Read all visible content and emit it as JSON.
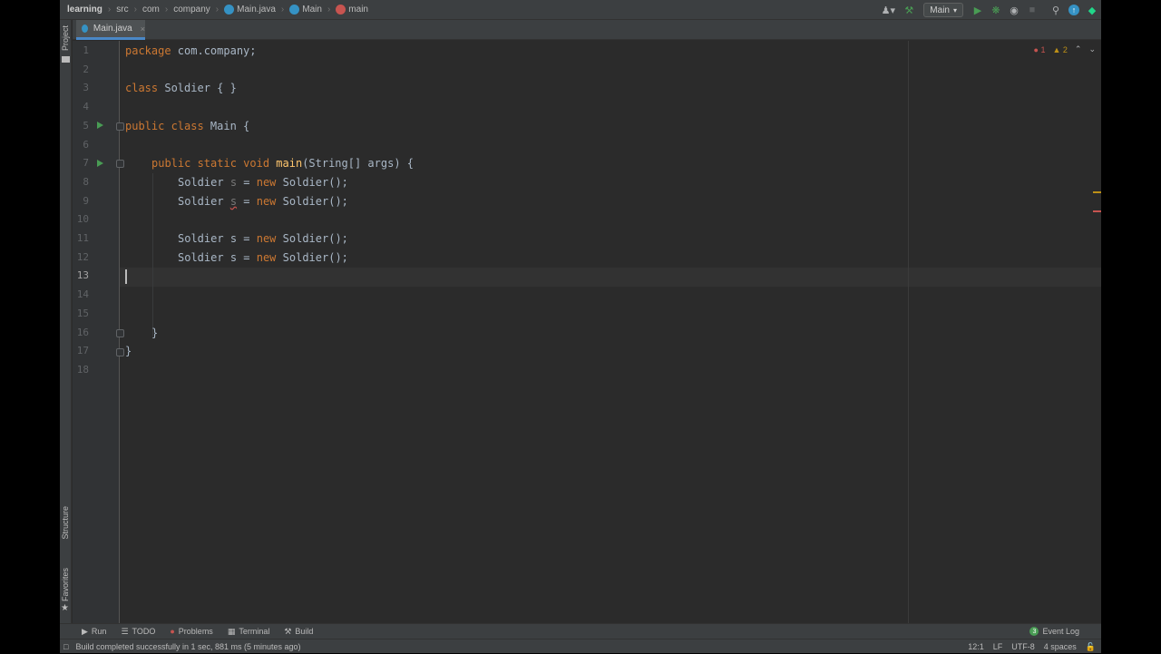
{
  "breadcrumbs": [
    "learning",
    "src",
    "com",
    "company",
    "Main.java",
    "Main",
    "main"
  ],
  "toolbar": {
    "run_config": "Main"
  },
  "left_strip": {
    "project_label": "Project",
    "structure_label": "Structure",
    "favorites_label": "Favorites"
  },
  "tabs": [
    {
      "label": "Main.java",
      "close": "×"
    }
  ],
  "editor": {
    "line_numbers": [
      "1",
      "2",
      "3",
      "4",
      "5",
      "6",
      "7",
      "8",
      "9",
      "10",
      "11",
      "12",
      "13",
      "14",
      "15",
      "16",
      "17",
      "18"
    ],
    "current_line": 13,
    "code": {
      "l1_kw": "package",
      "l1_rest": " com.company;",
      "l3_kw": "class",
      "l3_rest": " Soldier { }",
      "l5_kw": "public class",
      "l5_rest": " Main {",
      "l7_kw": "public static void",
      "l7_fn": "main",
      "l7_rest": "(String[] args) {",
      "decl_type": "Soldier",
      "decl_var": "s",
      "decl_eq": " = ",
      "decl_new": "new",
      "decl_ctor": " Soldier();",
      "close_inner": "}",
      "close_outer": "}"
    },
    "inspections": {
      "errors": "1",
      "warnings": "2"
    }
  },
  "bottom_tabs": {
    "run": "Run",
    "todo": "TODO",
    "problems": "Problems",
    "terminal": "Terminal",
    "build": "Build",
    "event_log": "Event Log",
    "event_count": "3"
  },
  "status": {
    "message": "Build completed successfully in 1 sec, 881 ms (5 minutes ago)",
    "position": "12:1",
    "line_sep": "LF",
    "encoding": "UTF-8",
    "indent": "4 spaces"
  },
  "colors": {
    "keyword": "#cc7832",
    "function": "#ffc66d",
    "text": "#a9b7c6",
    "run_green": "#499c54",
    "error_red": "#c75450"
  }
}
